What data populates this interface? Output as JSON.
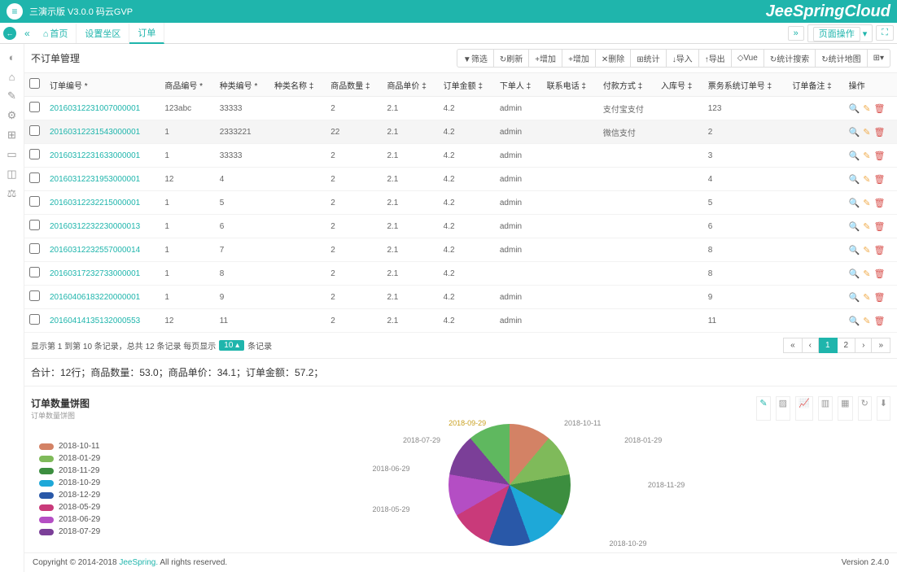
{
  "header": {
    "title": "三演示版 V3.0.0 码云GVP",
    "brand": "JeeSpringCloud"
  },
  "tabs": {
    "home": "首页",
    "tab1": "设置坐区",
    "tab2": "订单",
    "right1": "页面操作",
    "close": "✕"
  },
  "page": {
    "title": "不订单管理"
  },
  "toolbar": {
    "filter": "▼筛选",
    "refresh": "↻刷新",
    "add": "+增加",
    "addall": "+增加",
    "delete": "✕删除",
    "stats": "⊞统计",
    "import": "↓导入",
    "export": "↑导出",
    "vue": "◇Vue",
    "statview": "↻统计搜索",
    "statchart": "↻统计地图",
    "grid": "⊞▾"
  },
  "columns": {
    "c0": "",
    "c1": "订单编号 *",
    "c2": "商品编号 *",
    "c3": "种类编号 *",
    "c4": "种类名称 ‡",
    "c5": "商品数量 ‡",
    "c6": "商品单价 ‡",
    "c7": "订单金额 ‡",
    "c8": "下单人 ‡",
    "c9": "联系电话 ‡",
    "c10": "付款方式 ‡",
    "c11": "入库号 ‡",
    "c12": "票务系统订单号 ‡",
    "c13": "订单备注 ‡",
    "c14": "操作"
  },
  "rows": [
    {
      "id": "201603122310070000​01",
      "pn": "123abc",
      "cat": "33333",
      "qty": "2",
      "price": "2.1",
      "amt": "4.2",
      "user": "admin",
      "pay": "支付宝支付",
      "stock": "",
      "ticket": "123"
    },
    {
      "id": "2016031223154300​0001",
      "pn": "1",
      "cat": "2333221",
      "qty": "22",
      "price": "2.1",
      "amt": "4.2",
      "user": "admin",
      "pay": "微信支付",
      "stock": "",
      "ticket": "2",
      "hl": true
    },
    {
      "id": "201603122316330​00001",
      "pn": "1",
      "cat": "33333",
      "qty": "2",
      "price": "2.1",
      "amt": "4.2",
      "user": "admin",
      "pay": "",
      "stock": "",
      "ticket": "3"
    },
    {
      "id": "201603122319530​00001",
      "pn": "12",
      "cat": "4",
      "qty": "2",
      "price": "2.1",
      "amt": "4.2",
      "user": "admin",
      "pay": "",
      "stock": "",
      "ticket": "4"
    },
    {
      "id": "201603122322150​00001",
      "pn": "1",
      "cat": "5",
      "qty": "2",
      "price": "2.1",
      "amt": "4.2",
      "user": "admin",
      "pay": "",
      "stock": "",
      "ticket": "5"
    },
    {
      "id": "201603122322300​00013",
      "pn": "1",
      "cat": "6",
      "qty": "2",
      "price": "2.1",
      "amt": "4.2",
      "user": "admin",
      "pay": "",
      "stock": "",
      "ticket": "6"
    },
    {
      "id": "201603122325570​00014",
      "pn": "1",
      "cat": "7",
      "qty": "2",
      "price": "2.1",
      "amt": "4.2",
      "user": "admin",
      "pay": "",
      "stock": "",
      "ticket": "8"
    },
    {
      "id": "201603172327330​00001",
      "pn": "1",
      "cat": "8",
      "qty": "2",
      "price": "2.1",
      "amt": "4.2",
      "user": "",
      "pay": "",
      "stock": "",
      "ticket": "8"
    },
    {
      "id": "201604061832200​00001",
      "pn": "1",
      "cat": "9",
      "qty": "2",
      "price": "2.1",
      "amt": "4.2",
      "user": "admin",
      "pay": "",
      "stock": "",
      "ticket": "9"
    },
    {
      "id": "201604141351320​00553",
      "pn": "12",
      "cat": "11",
      "qty": "2",
      "price": "2.1",
      "amt": "4.2",
      "user": "admin",
      "pay": "",
      "stock": "",
      "ticket": "11"
    }
  ],
  "pagination": {
    "info_prefix": "显示第 1 到第 10 条记录，总共 12 条记录 每页显示",
    "page_size": "10 ▴",
    "info_suffix": "条记录",
    "first": "«",
    "prev": "‹",
    "p1": "1",
    "p2": "2",
    "next": "›",
    "last": "»"
  },
  "summary": "合计：12行；商品数量：53.0；商品单价：34.1；订单金额：57.2；",
  "chart": {
    "title": "订单数量饼图",
    "subtitle": "订单数量饼图",
    "legend": [
      {
        "label": "2018-10-11",
        "color": "#d38265"
      },
      {
        "label": "2018-01-29",
        "color": "#7fba5a"
      },
      {
        "label": "2018-11-29",
        "color": "#3c8e3f"
      },
      {
        "label": "2018-10-29",
        "color": "#1ea8d8"
      },
      {
        "label": "2018-12-29",
        "color": "#2958a8"
      },
      {
        "label": "2018-05-29",
        "color": "#c93a7a"
      },
      {
        "label": "2018-06-29",
        "color": "#b44ec4"
      },
      {
        "label": "2018-07-29",
        "color": "#7b3f98"
      }
    ],
    "pie_labels": {
      "l1": "2018-10-11",
      "l2": "2018-01-29",
      "l3": "2018-11-29",
      "l4": "2018-10-29",
      "l5": "2018-05-29",
      "l6": "2018-06-29",
      "l7": "2018-07-29",
      "l8": "2018-09-29"
    }
  },
  "chart_data": {
    "type": "pie",
    "title": "订单数量饼图",
    "series": [
      {
        "name": "2018-10-11",
        "value": 1,
        "color": "#d38265"
      },
      {
        "name": "2018-01-29",
        "value": 1,
        "color": "#7fba5a"
      },
      {
        "name": "2018-11-29",
        "value": 1,
        "color": "#3c8e3f"
      },
      {
        "name": "2018-10-29",
        "value": 1,
        "color": "#1ea8d8"
      },
      {
        "name": "2018-12-29",
        "value": 1,
        "color": "#2958a8"
      },
      {
        "name": "2018-05-29",
        "value": 1,
        "color": "#c93a7a"
      },
      {
        "name": "2018-06-29",
        "value": 1,
        "color": "#b44ec4"
      },
      {
        "name": "2018-07-29",
        "value": 1,
        "color": "#7b3f98"
      },
      {
        "name": "2018-09-29",
        "value": 1,
        "color": "#5fb85f"
      }
    ]
  },
  "footer": {
    "copyright_prefix": "Copyright © 2014-2018 ",
    "link": "JeeSpring.",
    "copyright_suffix": " All rights reserved.",
    "version": "Version 2.4.0"
  }
}
